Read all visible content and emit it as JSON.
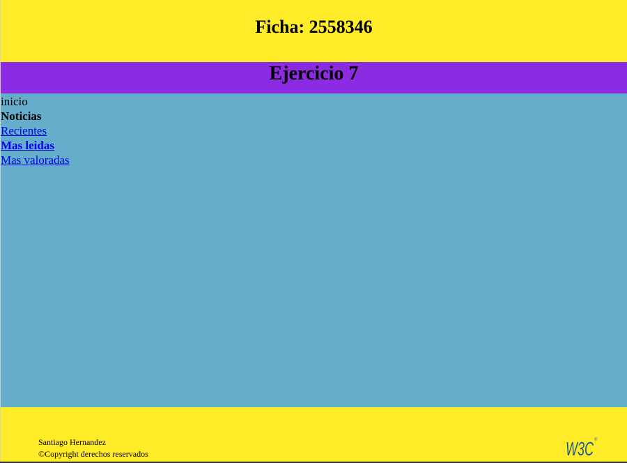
{
  "header": {
    "title": "Ficha: 2558346"
  },
  "banner": {
    "title": "Ejercicio 7"
  },
  "nav": {
    "home": "inicio",
    "section": "Noticias",
    "items": [
      {
        "label": "Recientes",
        "bold": false
      },
      {
        "label": "Mas leidas",
        "bold": true
      },
      {
        "label": "Mas valoradas",
        "bold": false
      }
    ]
  },
  "footer": {
    "author": "Santiago Hernandez",
    "copyright": "©Copyright derechos reservados",
    "logo": "W3C"
  },
  "colors": {
    "header_bg": "#ffeb27",
    "banner_bg": "#8d2be2",
    "content_bg": "#64aecb",
    "link": "#0000ee",
    "w3c_blue": "#1c5b8c"
  }
}
